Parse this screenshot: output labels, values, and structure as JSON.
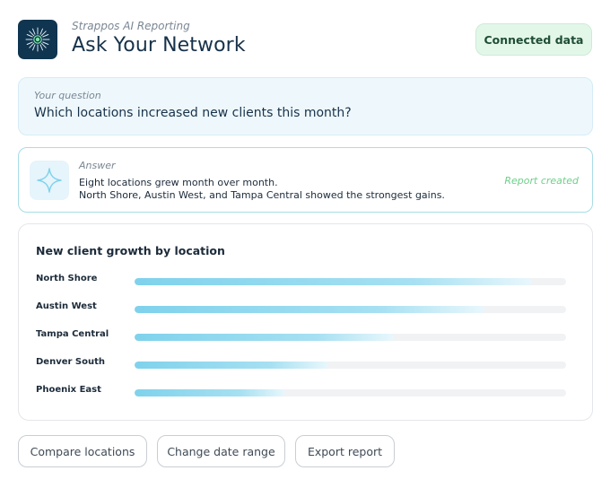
{
  "header": {
    "app_subtitle": "Strappos AI Reporting",
    "title": "Ask Your Network",
    "connected_label": "Connected data"
  },
  "question": {
    "label": "Your question",
    "text": "Which locations increased new clients this month?"
  },
  "answer": {
    "label": "Answer",
    "line1": "Eight locations grew month over month.",
    "line2": "North Shore, Austin West, and Tampa Central showed the strongest gains.",
    "status": "Report created"
  },
  "chart_data": {
    "type": "bar",
    "title": "New client growth by location",
    "categories": [
      "North Shore",
      "Austin West",
      "Tampa Central",
      "Denver South",
      "Phoenix East"
    ],
    "values": [
      0.92,
      0.81,
      0.6,
      0.45,
      0.35
    ],
    "ylim": [
      0,
      1
    ],
    "grid": false
  },
  "buttons": {
    "compare": "Compare locations",
    "date_range": "Change date range",
    "export": "Export report"
  },
  "colors": {
    "brand_dark": "#0f3550",
    "accent_cyan": "#7fd2ec",
    "success_green": "#6fcf8a",
    "connected_bg": "#e3f7e9"
  },
  "icons": {
    "logo": "starburst-logo-icon",
    "answer": "sparkle-icon"
  }
}
